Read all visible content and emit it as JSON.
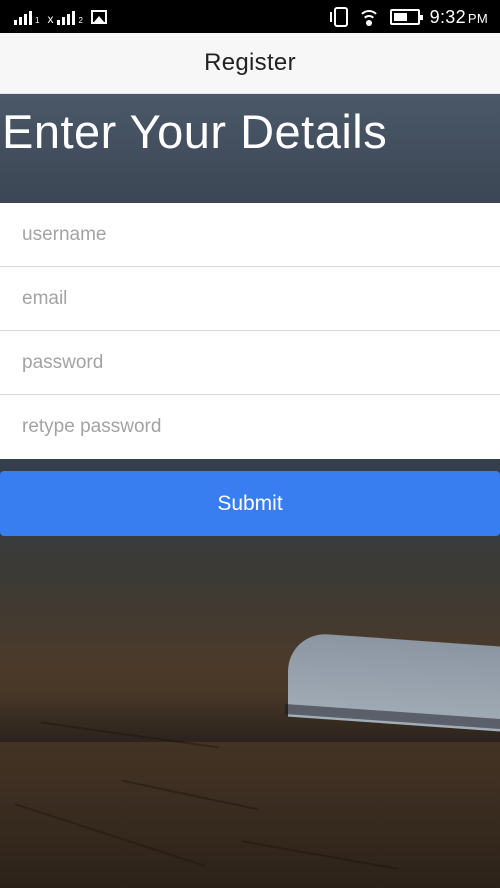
{
  "status_bar": {
    "sim1_label": "",
    "sim2_label": "x",
    "sim2_sub": "2",
    "sim1_sub": "1",
    "time": "9:32",
    "ampm": "PM",
    "icons": [
      "signal-icon",
      "signal-icon",
      "image-icon",
      "vibrate-icon",
      "wifi-icon",
      "battery-icon"
    ]
  },
  "app_bar": {
    "title": "Register"
  },
  "heading": "Enter Your Details",
  "form": {
    "username_placeholder": "username",
    "email_placeholder": "email",
    "password_placeholder": "password",
    "retype_placeholder": "retype password",
    "submit_label": "Submit"
  },
  "colors": {
    "accent": "#387ef0",
    "app_bar_bg": "#f7f7f7",
    "status_bar_bg": "#000000"
  }
}
